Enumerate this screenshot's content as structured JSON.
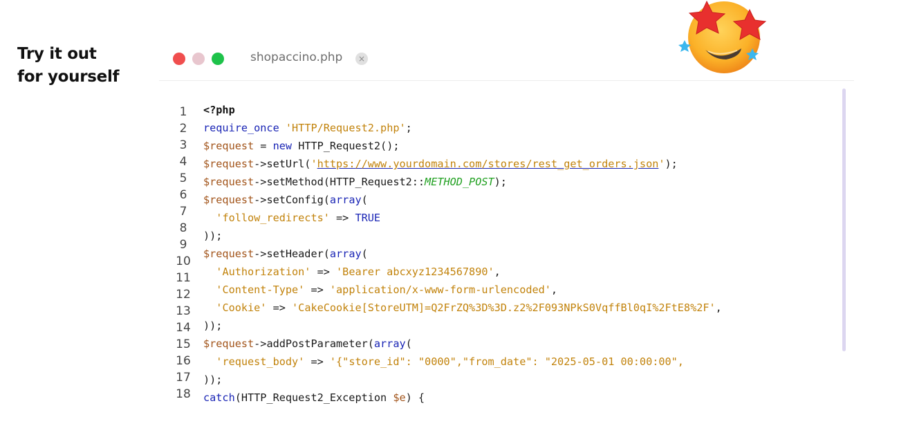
{
  "tagline": {
    "line1": "Try it out",
    "line2": "for yourself"
  },
  "window": {
    "tab_title": "shopaccino.php",
    "close_glyph": "×",
    "controls": [
      "close-dot",
      "minimize-dot",
      "maximize-dot"
    ]
  },
  "code": {
    "line_numbers": [
      "1",
      "2",
      "3",
      "4",
      "5",
      "6",
      "7",
      "8",
      "9",
      "10",
      "11",
      "12",
      "13",
      "14",
      "15",
      "16",
      "17",
      "18"
    ],
    "l1": "<?php",
    "l2_fn": "require_once",
    "l2_str": "'HTTP/Request2.php'",
    "l3_var": "$request",
    "l3_kw": "new",
    "l3_rest": "HTTP_Request2();",
    "l4_var": "$request",
    "l4_method": "->setUrl(",
    "l4_q1": "'",
    "l4_url": "https://www.yourdomain.com/stores/rest_get_orders.json",
    "l4_q2": "'",
    "l4_end": ");",
    "l5_var": "$request",
    "l5_method": "->setMethod(HTTP_Request2::",
    "l5_const": "METHOD_POST",
    "l5_end": ");",
    "l6_var": "$request",
    "l6_method": "->setConfig(",
    "l6_kw": "array",
    "l6_end": "(",
    "l7_key": "'follow_redirects'",
    "l7_arrow": " => ",
    "l7_val": "TRUE",
    "l8": "));",
    "l9_var": "$request",
    "l9_method": "->setHeader(",
    "l9_kw": "array",
    "l9_end": "(",
    "l10_key": "'Authorization'",
    "l10_val": "'Bearer abcxyz1234567890'",
    "l11_key": "'Content-Type'",
    "l11_val": "'application/x-www-form-urlencoded'",
    "l12_key": "'Cookie'",
    "l12_val": "'CakeCookie[StoreUTM]=Q2FrZQ%3D%3D.z2%2F093NPkS0VqffBl0qI%2FtE8%2F'",
    "l13": "));",
    "l14_var": "$request",
    "l14_method": "->addPostParameter(",
    "l14_kw": "array",
    "l14_end": "(",
    "l15_key": "'request_body'",
    "l15_val": "'{\"store_id\": \"0000\",\"from_date\": \"2025-05-01 00:00:00\",",
    "l16": "));",
    "l17_kw": "catch",
    "l17_rest": "(HTTP_Request2_Exception ",
    "l17_var": "$e",
    "l17_end": ") {",
    "arrow": " => ",
    "comma": ",",
    "semicolon": ";",
    "space": " ",
    "equals": " = "
  },
  "decor": {
    "emoji_icon": "star-struck-emoji-icon"
  },
  "colors": {
    "keyword": "#1a25b5",
    "variable": "#a2541a",
    "string": "#c2830c",
    "class_constant": "#20a020",
    "scrollbar": "#dcd6f0"
  }
}
